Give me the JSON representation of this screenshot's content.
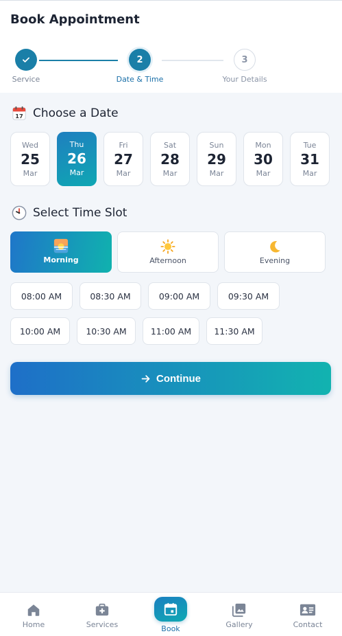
{
  "header": {
    "title": "Book Appointment"
  },
  "steps": [
    {
      "number": "1",
      "label": "Service",
      "state": "done"
    },
    {
      "number": "2",
      "label": "Date & Time",
      "state": "current"
    },
    {
      "number": "3",
      "label": "Your Details",
      "state": "upcoming"
    }
  ],
  "date_section": {
    "icon": "calendar-icon",
    "title": "Choose a Date"
  },
  "dates": [
    {
      "dow": "Wed",
      "day": "25",
      "month": "Mar"
    },
    {
      "dow": "Thu",
      "day": "26",
      "month": "Mar",
      "selected": true
    },
    {
      "dow": "Fri",
      "day": "27",
      "month": "Mar"
    },
    {
      "dow": "Sat",
      "day": "28",
      "month": "Mar"
    },
    {
      "dow": "Sun",
      "day": "29",
      "month": "Mar"
    },
    {
      "dow": "Mon",
      "day": "30",
      "month": "Mar"
    },
    {
      "dow": "Tue",
      "day": "31",
      "month": "Mar"
    }
  ],
  "time_section": {
    "icon": "clock-icon",
    "title": "Select Time Slot"
  },
  "periods": [
    {
      "label": "Morning",
      "icon": "sunrise-icon",
      "active": true
    },
    {
      "label": "Afternoon",
      "icon": "sun-icon"
    },
    {
      "label": "Evening",
      "icon": "moon-icon"
    }
  ],
  "slots": [
    "08:00 AM",
    "08:30 AM",
    "09:00 AM",
    "09:30 AM",
    "10:00 AM",
    "10:30 AM",
    "11:00 AM",
    "11:30 AM"
  ],
  "continue": {
    "label": "Continue",
    "icon": "arrow-right-icon"
  },
  "nav": [
    {
      "label": "Home",
      "icon": "home-icon"
    },
    {
      "label": "Services",
      "icon": "medical-kit-icon"
    },
    {
      "label": "Book",
      "icon": "calendar-icon",
      "active": true
    },
    {
      "label": "Gallery",
      "icon": "gallery-icon"
    },
    {
      "label": "Contact",
      "icon": "contact-card-icon"
    }
  ],
  "colors": {
    "accent": "#1a7fa8",
    "gradient_start": "#1e6fc8",
    "gradient_end": "#12b3b0",
    "background": "#f3f6fa"
  }
}
